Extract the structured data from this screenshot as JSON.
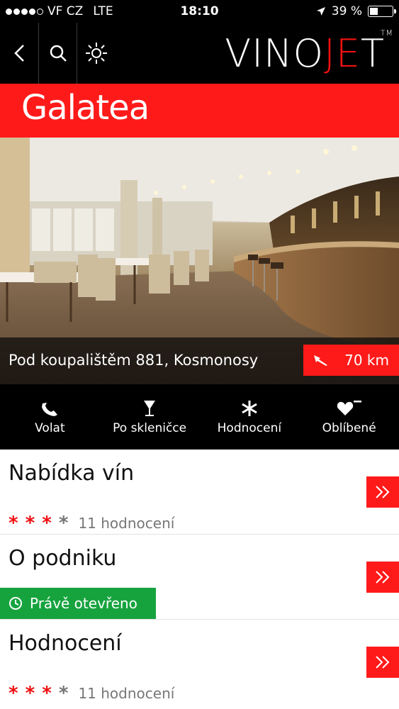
{
  "status": {
    "carrier": "VF CZ",
    "network": "LTE",
    "time": "18:10",
    "battery": "39 %",
    "battery_level": 0.39,
    "signal_bars": 4
  },
  "nav": {
    "logo_prefix": "VINO",
    "logo_red": "JE",
    "logo_suffix": "T",
    "logo_tm": "TM"
  },
  "venue": {
    "name": "Galatea",
    "address": "Pod koupalištěm 881, Kosmonosy",
    "distance": "70 km"
  },
  "actions": [
    {
      "label": "Volat",
      "icon": "phone-icon"
    },
    {
      "label": "Po skleničce",
      "icon": "wine-glass-icon"
    },
    {
      "label": "Hodnocení",
      "icon": "asterisk-icon"
    },
    {
      "label": "Oblíbené",
      "icon": "heart-minus-icon"
    }
  ],
  "sections": {
    "wines": {
      "title": "Nabídka vín",
      "rating_count": "11 hodnocení",
      "stars": 3,
      "stars_total": 4
    },
    "about": {
      "title": "O podniku",
      "open_status": "Právě otevřeno"
    },
    "reviews": {
      "title": "Hodnocení",
      "rating_count": "11 hodnocení",
      "stars": 3,
      "stars_total": 4
    }
  },
  "colors": {
    "accent": "#ff1a1a",
    "open_green": "#16a33e",
    "bar_black": "#000000"
  }
}
